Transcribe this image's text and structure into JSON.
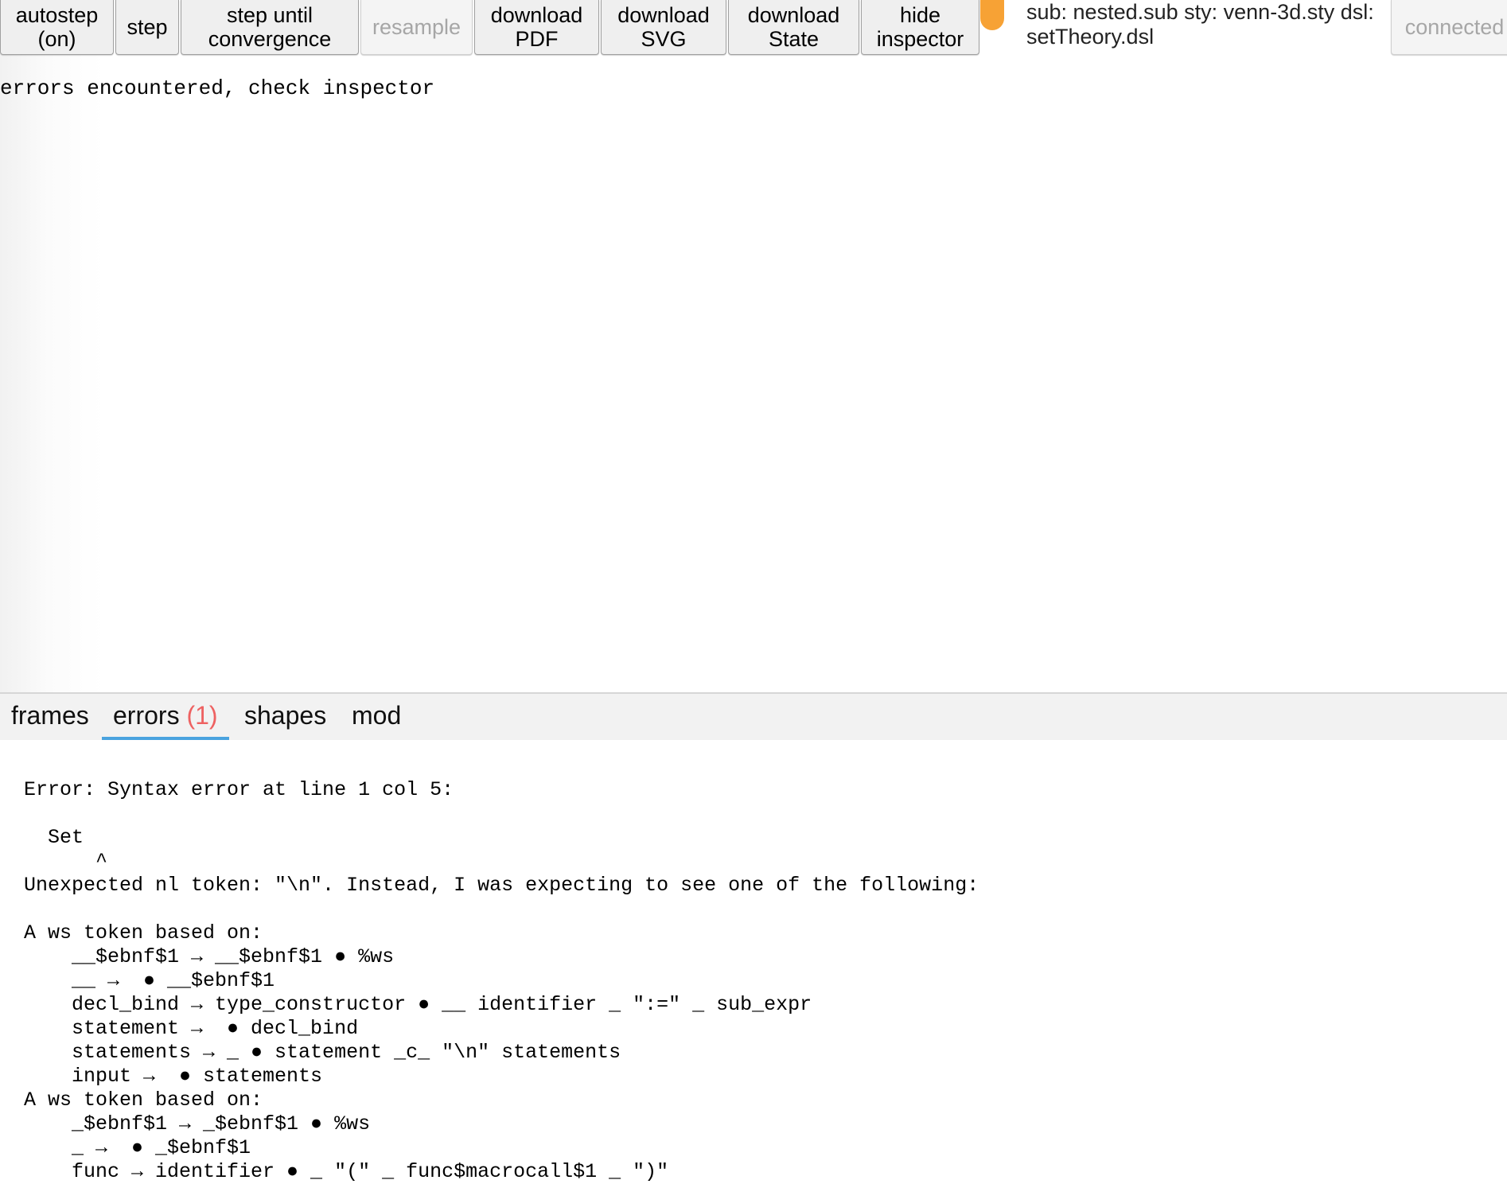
{
  "toolbar": {
    "autostep_label": "autostep\n(on)",
    "step_label": "step",
    "step_until_label": "step until\nconvergence",
    "resample_label": "resample",
    "download_pdf_label": "download\nPDF",
    "download_svg_label": "download\nSVG",
    "download_state_label": "download\nState",
    "hide_inspector_label": "hide\ninspector",
    "status_color": "#f7a235",
    "file_info_line1": "sub: nested.sub sty: venn-3d.sty dsl:",
    "file_info_line2": "setTheory.dsl",
    "connected_label": "connected"
  },
  "canvas": {
    "message": "errors encountered, check inspector"
  },
  "inspector": {
    "tabs": [
      {
        "label": "frames"
      },
      {
        "label": "errors ",
        "count": "(1)"
      },
      {
        "label": "shapes"
      },
      {
        "label": "mod"
      }
    ],
    "active_tab": "errors",
    "accent_color": "#4aa3df",
    "error_count_color": "#ee6161",
    "error_text": "Error: Syntax error at line 1 col 5:\n\n  Set\n      ^\nUnexpected nl token: \"\\n\". Instead, I was expecting to see one of the following:\n\nA ws token based on:\n    __$ebnf$1 → __$ebnf$1 ● %ws\n    __ →  ● __$ebnf$1\n    decl_bind → type_constructor ● __ identifier _ \":=\" _ sub_expr\n    statement →  ● decl_bind\n    statements → _ ● statement _c_ \"\\n\" statements\n    input →  ● statements\nA ws token based on:\n    _$ebnf$1 → _$ebnf$1 ● %ws\n    _ →  ● _$ebnf$1\n    func → identifier ● _ \"(\" _ func$macrocall$1 _ \")\""
  }
}
